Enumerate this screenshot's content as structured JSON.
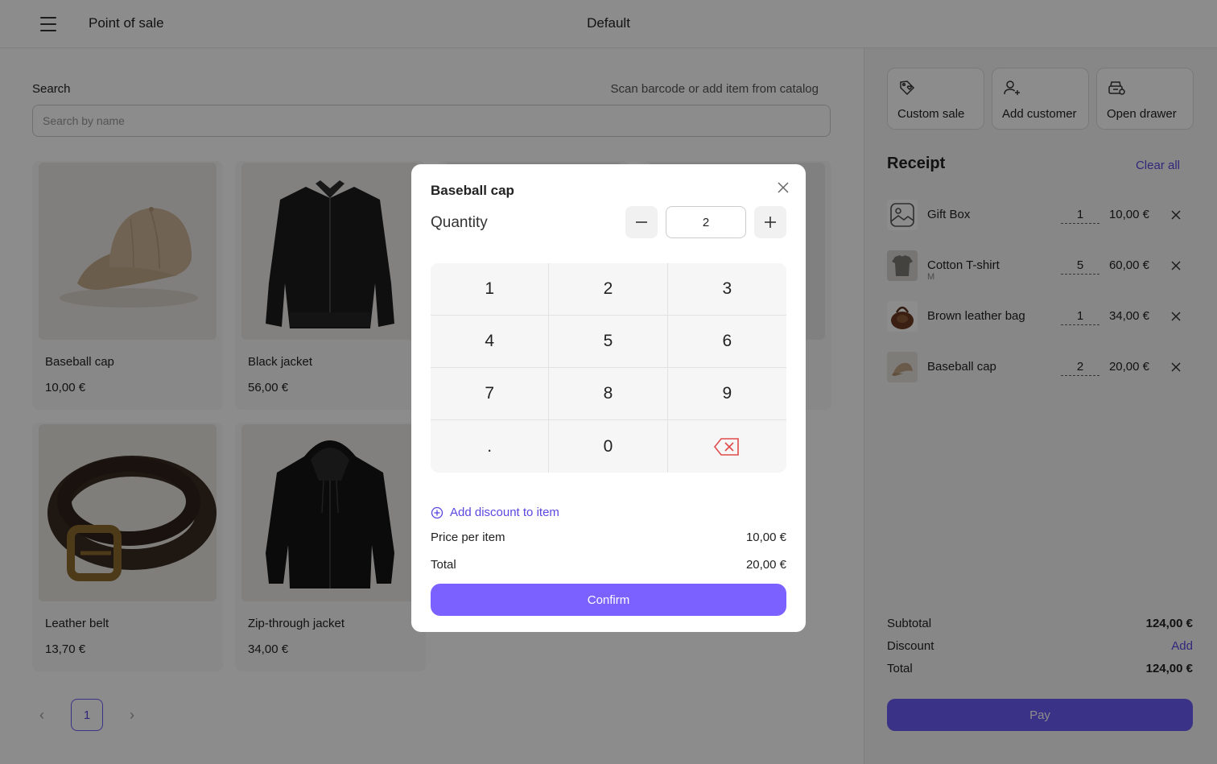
{
  "topbar": {
    "app_title": "Point of sale",
    "register_name": "Default"
  },
  "search": {
    "label": "Search",
    "hint": "Scan barcode or add item from catalog",
    "placeholder": "Search by name"
  },
  "catalog": [
    {
      "name": "Baseball cap",
      "price": "10,00 €"
    },
    {
      "name": "Black jacket",
      "price": "56,00 €"
    },
    {
      "name": "",
      "price": ""
    },
    {
      "name": "",
      "price": ""
    },
    {
      "name": "Leather belt",
      "price": "13,70 €"
    },
    {
      "name": "Zip-through jacket",
      "price": "34,00 €"
    }
  ],
  "pagination": {
    "current_page": "1"
  },
  "sidebar": {
    "actions": [
      {
        "label": "Custom sale",
        "icon": "tag-heart-icon"
      },
      {
        "label": "Add customer",
        "icon": "user-plus-icon"
      },
      {
        "label": "Open drawer",
        "icon": "cash-drawer-icon"
      }
    ],
    "receipt_title": "Receipt",
    "clear_all": "Clear all",
    "lines": [
      {
        "name": "Gift Box",
        "variant": "",
        "qty": "1",
        "price": "10,00 €"
      },
      {
        "name": "Cotton T-shirt",
        "variant": "M",
        "qty": "5",
        "price": "60,00 €"
      },
      {
        "name": "Brown leather bag",
        "variant": "",
        "qty": "1",
        "price": "34,00 €"
      },
      {
        "name": "Baseball cap",
        "variant": "",
        "qty": "2",
        "price": "20,00 €"
      }
    ],
    "subtotal_label": "Subtotal",
    "subtotal": "124,00 €",
    "discount_label": "Discount",
    "discount_action": "Add",
    "total_label": "Total",
    "total": "124,00 €",
    "pay_label": "Pay"
  },
  "modal": {
    "title": "Baseball cap",
    "quantity_label": "Quantity",
    "quantity_value": "2",
    "keys": [
      "1",
      "2",
      "3",
      "4",
      "5",
      "6",
      "7",
      "8",
      "9",
      ".",
      "0"
    ],
    "add_discount": "Add discount to item",
    "price_per_item_label": "Price per item",
    "price_per_item": "10,00 €",
    "total_label": "Total",
    "total": "20,00 €",
    "confirm_label": "Confirm"
  },
  "colors": {
    "accent": "#6b5cf6",
    "accent_text": "#5a48e0",
    "backspace": "#e04a4a"
  }
}
